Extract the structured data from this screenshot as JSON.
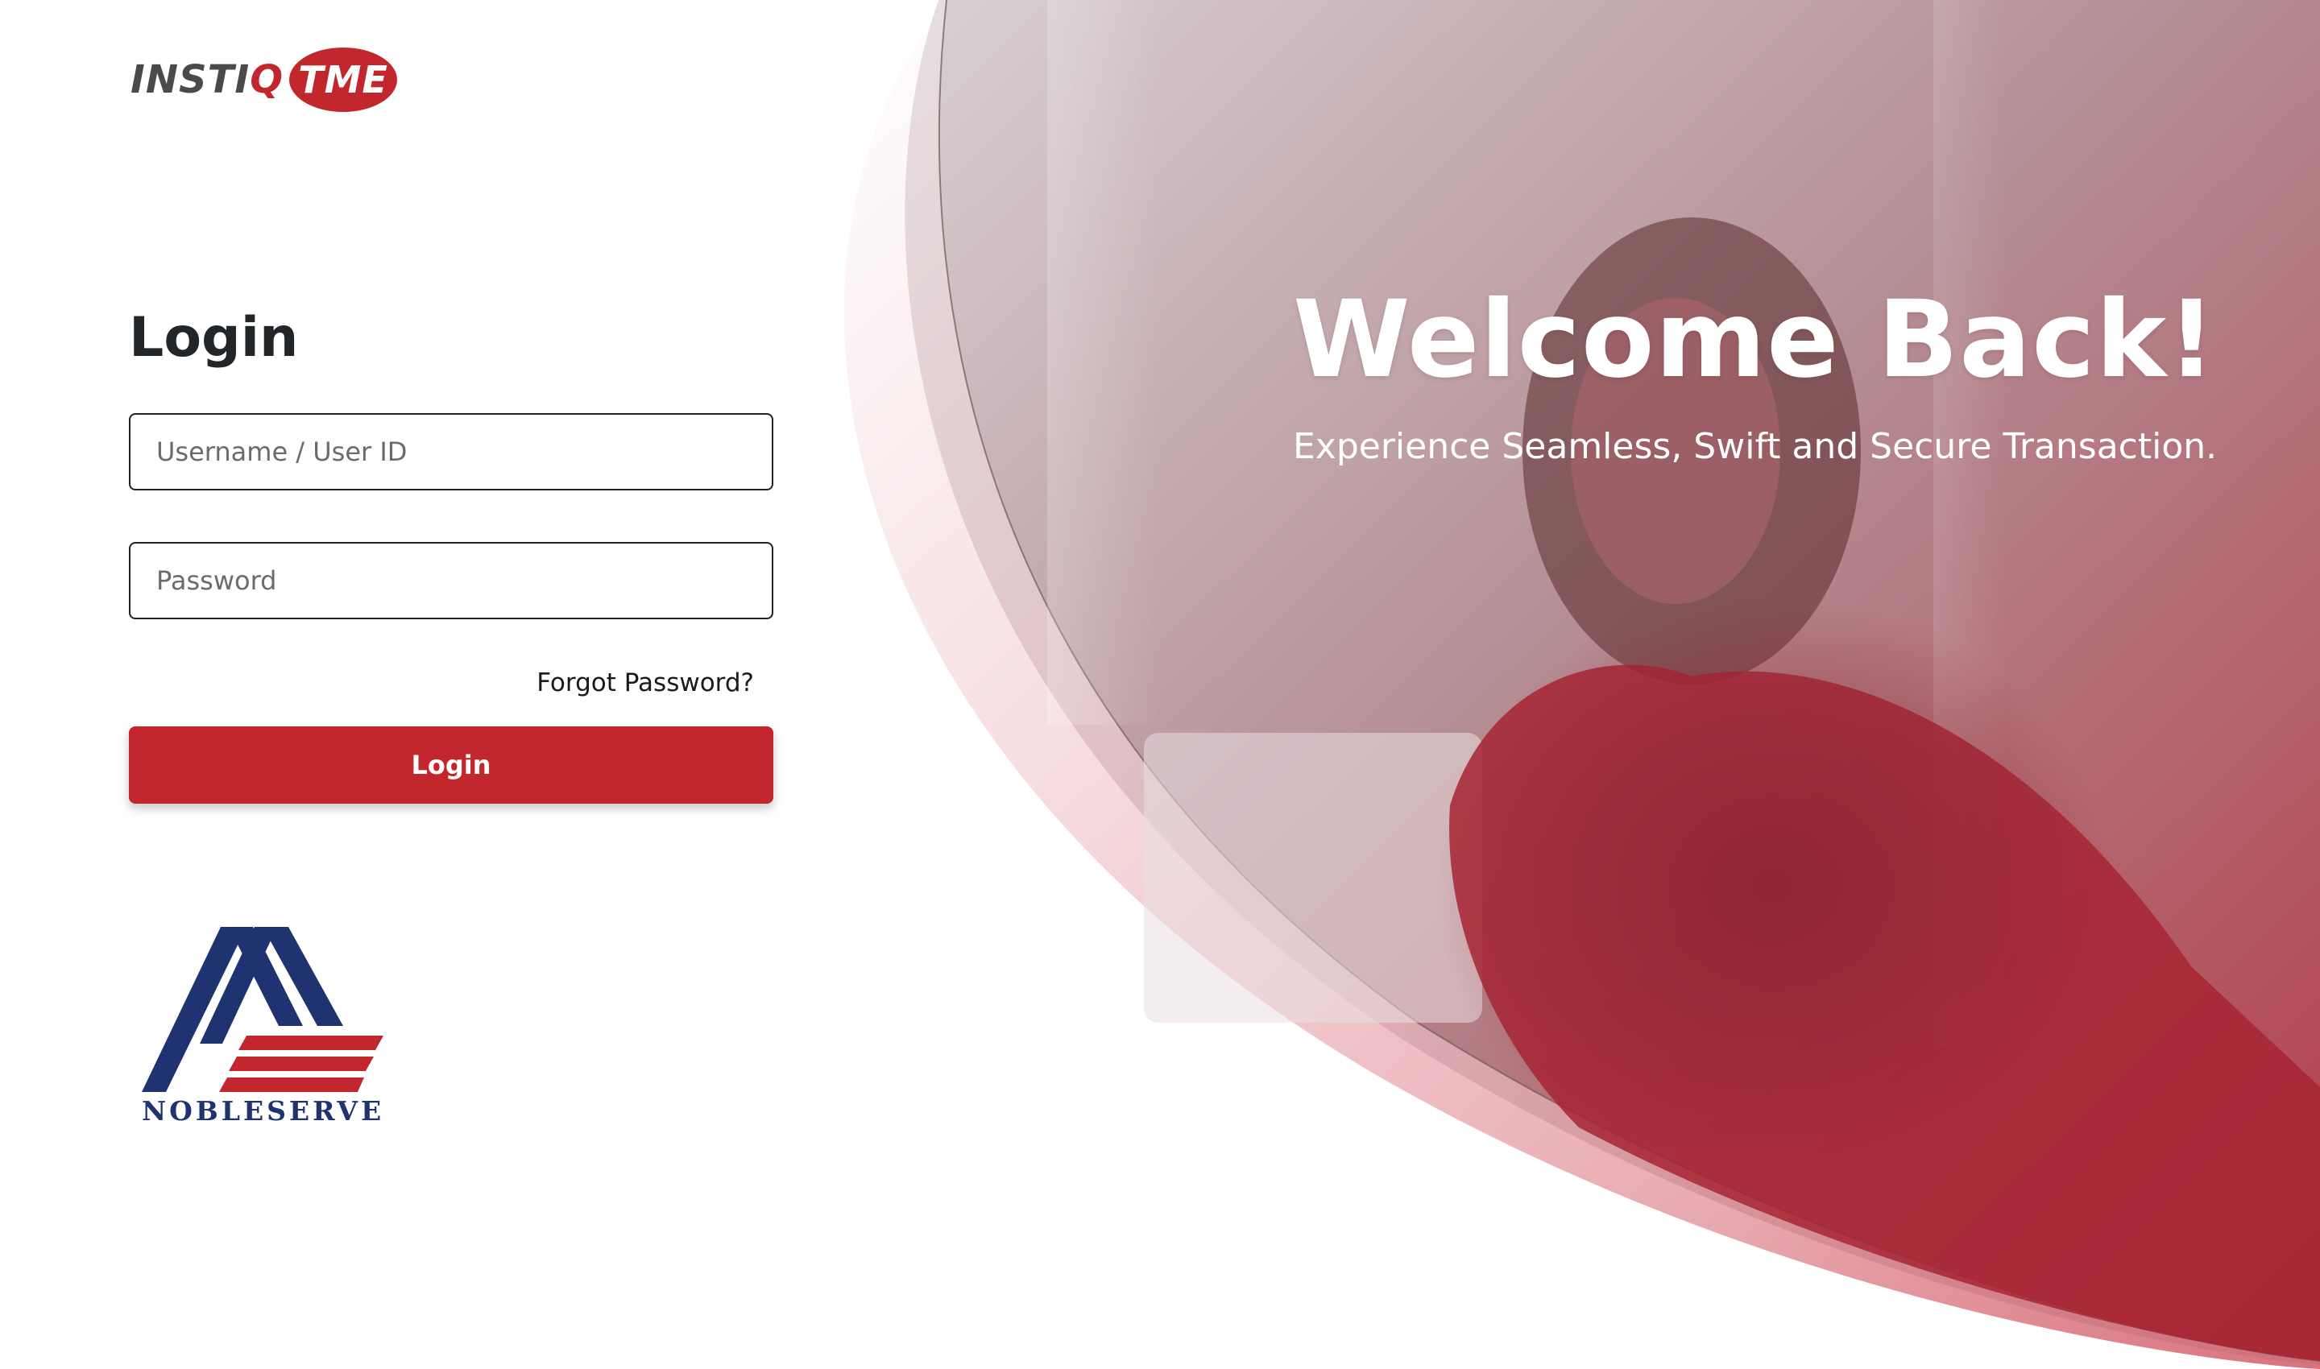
{
  "brand": {
    "left_text": "INSTI",
    "q_letter": "Q",
    "pill_text": "TME",
    "colors": {
      "text": "#4a4a4a",
      "accent": "#c1272d"
    }
  },
  "login": {
    "title": "Login",
    "username_placeholder": "Username / User ID",
    "password_placeholder": "Password",
    "forgot_password": "Forgot Password?",
    "submit_label": "Login"
  },
  "hero": {
    "title": "Welcome Back!",
    "subtitle": "Experience Seamless, Swift and Secure Transaction."
  },
  "partner": {
    "name": "NOBLESERVE",
    "colors": {
      "navy": "#1f3370",
      "red": "#c1272d"
    }
  },
  "colors": {
    "primary": "#c1272d",
    "text_dark": "#222629",
    "hero_overlay": "#b23a45"
  }
}
